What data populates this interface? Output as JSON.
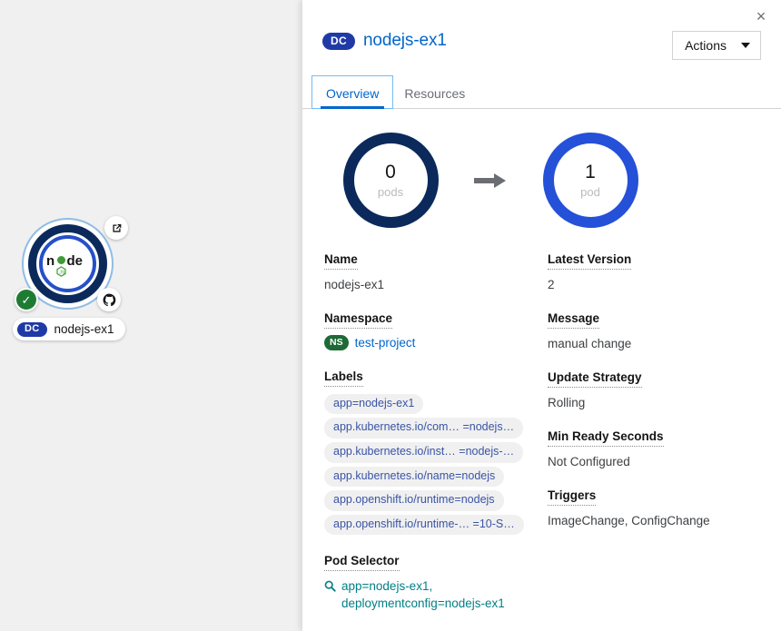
{
  "topology": {
    "node": {
      "name": "nodejs-ex1",
      "kind_badge": "DC",
      "logo_text": "node",
      "decorators": [
        {
          "name": "external-link-icon",
          "title": "Open URL"
        },
        {
          "name": "status-check-icon",
          "title": "Running"
        },
        {
          "name": "github-icon",
          "title": "Edit source code"
        }
      ]
    }
  },
  "panel": {
    "close_label": "×",
    "kind_badge": "DC",
    "title": "nodejs-ex1",
    "actions": {
      "label": "Actions",
      "caret": "chevron-down-icon"
    },
    "tabs": [
      {
        "id": "overview",
        "label": "Overview",
        "active": true
      },
      {
        "id": "resources",
        "label": "Resources",
        "active": false
      }
    ]
  },
  "donuts": [
    {
      "count": "0",
      "label": "pods",
      "color": "#0b2a5b"
    },
    {
      "count": "1",
      "label": "pod",
      "color": "#2550d8"
    }
  ],
  "arrow": {
    "name": "arrow-right-icon",
    "color": "#6a6e73"
  },
  "details": {
    "left": [
      {
        "label": "Name",
        "value": "nodejs-ex1",
        "type": "text"
      },
      {
        "label": "Namespace",
        "value": "test-project",
        "type": "namespace",
        "badge": "NS"
      },
      {
        "label": "Labels",
        "type": "chips",
        "chips": [
          "app=nodejs-ex1",
          "app.kubernetes.io/com… =nodejs…",
          "app.kubernetes.io/inst… =nodejs-…",
          "app.kubernetes.io/name=nodejs",
          "app.openshift.io/runtime=nodejs",
          "app.openshift.io/runtime-… =10-S…"
        ]
      },
      {
        "label": "Pod Selector",
        "type": "selector",
        "value": "app=nodejs-ex1, deploymentconfig=nodejs-ex1",
        "line1": "app=nodejs-ex1,",
        "line2": "deploymentconfig=nodejs-ex1",
        "icon": "search-icon"
      }
    ],
    "right": [
      {
        "label": "Latest Version",
        "value": "2",
        "type": "text"
      },
      {
        "label": "Message",
        "value": "manual change",
        "type": "text"
      },
      {
        "label": "Update Strategy",
        "value": "Rolling",
        "type": "text"
      },
      {
        "label": "Min Ready Seconds",
        "value": "Not Configured",
        "type": "text"
      },
      {
        "label": "Triggers",
        "value": "ImageChange, ConfigChange",
        "type": "text"
      }
    ]
  },
  "colors": {
    "accent_blue": "#0066cc",
    "navy": "#0b2a5b",
    "bright_blue": "#2550d8",
    "green": "#1d6a36",
    "teal": "#007f86",
    "chip_text": "#3954a5",
    "canvas_bg": "#f0f0f0"
  }
}
